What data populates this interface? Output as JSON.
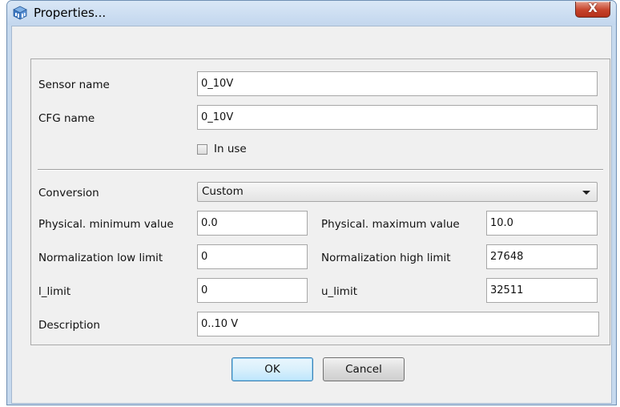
{
  "window": {
    "title": "Properties...",
    "icon": "properties-cube-icon",
    "close_glyph": "X"
  },
  "form": {
    "sensor_name": {
      "label": "Sensor name",
      "value": "0_10V"
    },
    "cfg_name": {
      "label": "CFG name",
      "value": "0_10V"
    },
    "in_use": {
      "label": "In use",
      "checked": false
    },
    "conversion": {
      "label": "Conversion",
      "value": "Custom"
    },
    "phys_min": {
      "label": "Physical. minimum value",
      "value": "0.0"
    },
    "phys_max": {
      "label": "Physical. maximum value",
      "value": "10.0"
    },
    "norm_low": {
      "label": "Normalization low limit",
      "value": "0"
    },
    "norm_high": {
      "label": "Normalization high limit",
      "value": "27648"
    },
    "l_limit": {
      "label": "l_limit",
      "value": "0"
    },
    "u_limit": {
      "label": "u_limit",
      "value": "32511"
    },
    "description": {
      "label": "Description",
      "value": "0..10 V"
    }
  },
  "buttons": {
    "ok": "OK",
    "cancel": "Cancel"
  },
  "colors": {
    "title_bar": "#c6d9ee",
    "close_button": "#c6432b",
    "client_background": "#f0f0f0"
  }
}
